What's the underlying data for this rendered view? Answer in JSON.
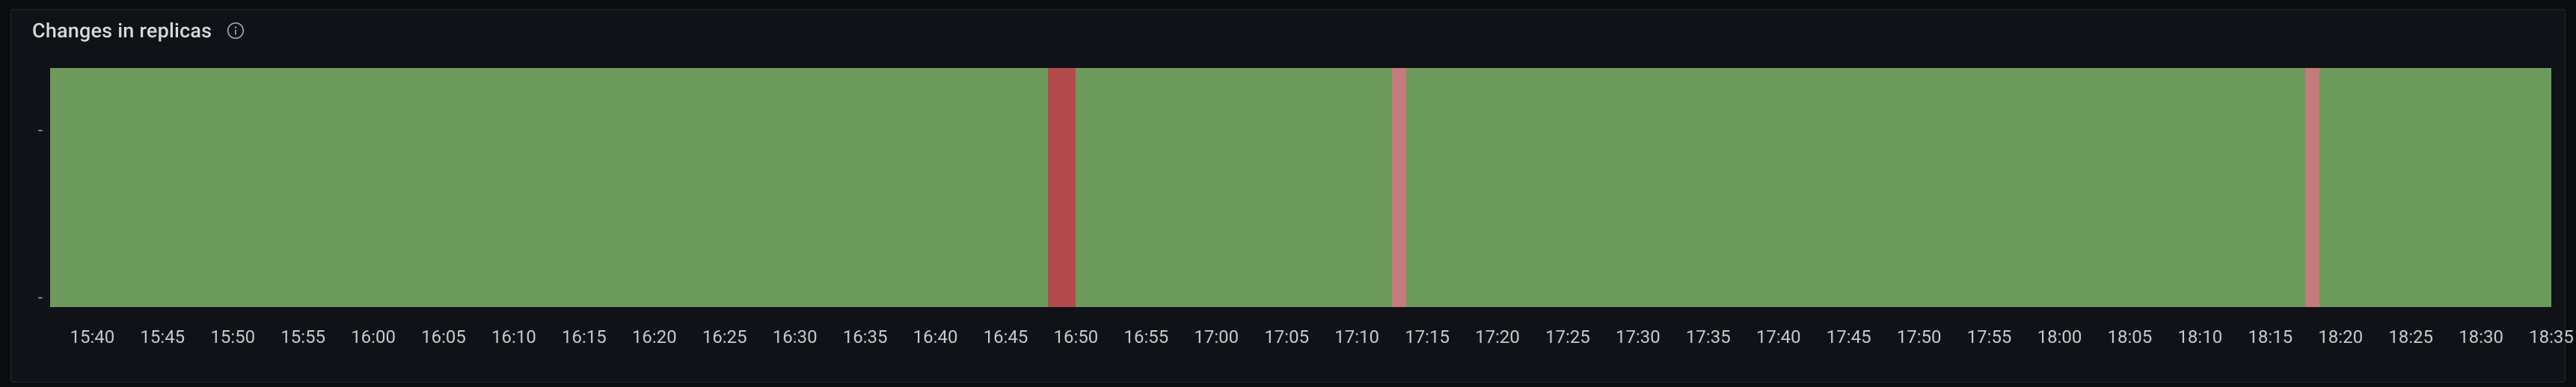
{
  "panel": {
    "title": "Changes in replicas",
    "info_icon": "info-circle"
  },
  "chart_data": {
    "type": "bar",
    "title": "Changes in replicas",
    "x_range_minutes": [
      937,
      1115
    ],
    "x_ticks": [
      "15:40",
      "15:45",
      "15:50",
      "15:55",
      "16:00",
      "16:05",
      "16:10",
      "16:15",
      "16:20",
      "16:25",
      "16:30",
      "16:35",
      "16:40",
      "16:45",
      "16:50",
      "16:55",
      "17:00",
      "17:05",
      "17:10",
      "17:15",
      "17:20",
      "17:25",
      "17:30",
      "17:35",
      "17:40",
      "17:45",
      "17:50",
      "17:55",
      "18:00",
      "18:05",
      "18:10",
      "18:15",
      "18:20",
      "18:25",
      "18:30",
      "18:35"
    ],
    "y_tick_labels": [
      "-",
      "-"
    ],
    "y_tick_positions_pct": [
      25,
      75
    ],
    "colors": {
      "ok": "#6c9a5b",
      "warn": "#c37b7d",
      "bad": "#b34a4d"
    },
    "segments": [
      {
        "start_min": 937,
        "end_min": 1008.0,
        "state": "ok"
      },
      {
        "start_min": 1008.0,
        "end_min": 1010.0,
        "state": "bad"
      },
      {
        "start_min": 1010.0,
        "end_min": 1032.5,
        "state": "ok"
      },
      {
        "start_min": 1032.5,
        "end_min": 1033.5,
        "state": "warn"
      },
      {
        "start_min": 1033.5,
        "end_min": 1097.5,
        "state": "ok"
      },
      {
        "start_min": 1097.5,
        "end_min": 1098.5,
        "state": "warn"
      },
      {
        "start_min": 1098.5,
        "end_min": 1115.0,
        "state": "ok"
      }
    ]
  }
}
